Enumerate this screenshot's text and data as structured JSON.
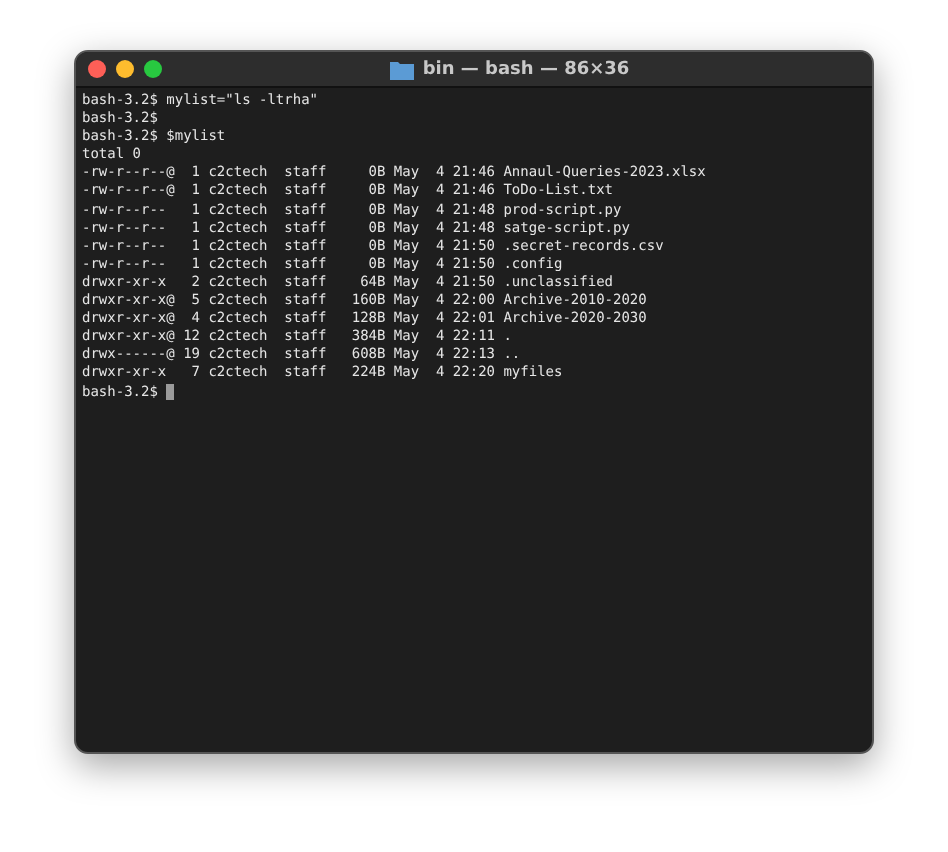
{
  "window": {
    "title": "bin — bash — 86×36"
  },
  "lines": [
    "bash-3.2$ mylist=\"ls -ltrha\"",
    "bash-3.2$",
    "bash-3.2$ $mylist",
    "total 0",
    "-rw-r--r--@  1 c2ctech  staff     0B May  4 21:46 Annaul-Queries-2023.xlsx",
    "-rw-r--r--@  1 c2ctech  staff     0B May  4 21:46 ToDo-List.txt",
    "-rw-r--r--   1 c2ctech  staff     0B May  4 21:48 prod-script.py",
    "-rw-r--r--   1 c2ctech  staff     0B May  4 21:48 satge-script.py",
    "-rw-r--r--   1 c2ctech  staff     0B May  4 21:50 .secret-records.csv",
    "-rw-r--r--   1 c2ctech  staff     0B May  4 21:50 .config",
    "drwxr-xr-x   2 c2ctech  staff    64B May  4 21:50 .unclassified",
    "drwxr-xr-x@  5 c2ctech  staff   160B May  4 22:00 Archive-2010-2020",
    "drwxr-xr-x@  4 c2ctech  staff   128B May  4 22:01 Archive-2020-2030",
    "drwxr-xr-x@ 12 c2ctech  staff   384B May  4 22:11 .",
    "drwx------@ 19 c2ctech  staff   608B May  4 22:13 ..",
    "drwxr-xr-x   7 c2ctech  staff   224B May  4 22:20 myfiles"
  ],
  "prompt": "bash-3.2$"
}
